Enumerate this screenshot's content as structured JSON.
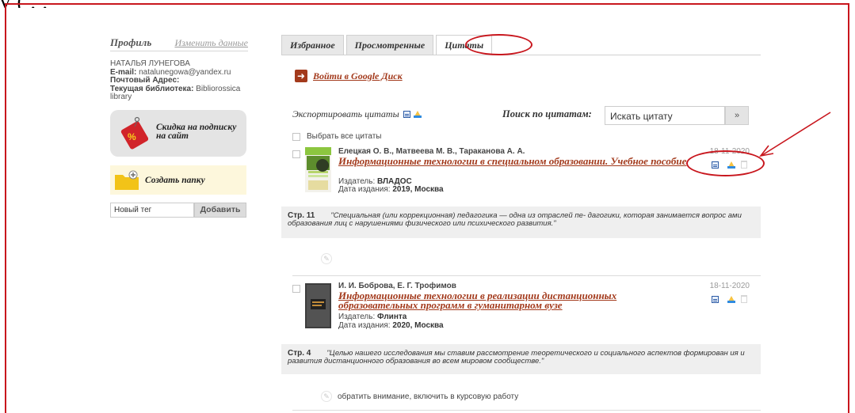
{
  "top_text": "у                             (                ,           ,                                                   ",
  "profile": {
    "title": "Профиль",
    "edit_link": "Изменить данные",
    "name": "НАТАЛЬЯ ЛУНЕГОВА",
    "email_label": "E-mail:",
    "email": "natalunegowa@yandex.ru",
    "address_label": "Почтовый Адрес:",
    "library_label": "Текущая библиотека:",
    "library": "Bibliorossica library"
  },
  "promo": {
    "line1": "Скидка на подписку",
    "line2": "на сайт",
    "badge": "%"
  },
  "folder": {
    "label": "Создать папку"
  },
  "tag": {
    "placeholder": "Новый тег",
    "add_label": "Добавить"
  },
  "tabs": [
    {
      "label": "Избранное"
    },
    {
      "label": "Просмотренные"
    },
    {
      "label": "Цитаты",
      "active": true
    }
  ],
  "gdrive": {
    "label": "Войти в Google Диск"
  },
  "export": {
    "label": "Экспортировать цитаты"
  },
  "search": {
    "label": "Поиск по цитатам:",
    "value": "Искать цитату",
    "button": "»"
  },
  "select_all": "Выбрать все цитаты",
  "entries": [
    {
      "authors": "Елецкая О. В., Матвеева М. В., Тараканова А. А.",
      "title": "Информационные технологии в специальном образовании. Учебное пособие",
      "publisher_label": "Издатель:",
      "publisher": "ВЛАДОС",
      "date_label": "Дата издания:",
      "date": "2019, Москва",
      "added": "18-11-2020",
      "quote_page": "Стр. 11",
      "quote": "\"Специальная (или коррекционная) педагогика — одна из отраслей пе- дагогики, которая занимается вопрос ами образования лиц с нарушениями физического или психического развития.\"",
      "note": ""
    },
    {
      "authors": "И. И. Боброва, Е. Г. Трофимов",
      "title": "Информационные технологии в реализации дистанционных образовательных программ в гуманитарном вузе",
      "publisher_label": "Издатель:",
      "publisher": "Флинта",
      "date_label": "Дата издания:",
      "date": "2020, Москва",
      "added": "18-11-2020",
      "quote_page": "Стр. 4",
      "quote": "\"Целью нашего исследования мы ставим рассмотрение теоретического и социального аспектов формирован ия и развития дистанционного образования во всем мировом сообществе.\"",
      "note": "обратить внимание, включить в курсовую работу"
    }
  ],
  "colors": {
    "accent": "#a33a1c",
    "annotation": "#c8161d",
    "panel": "#efefef",
    "folder": "#f2c318",
    "promo_tag": "#d1242a"
  }
}
